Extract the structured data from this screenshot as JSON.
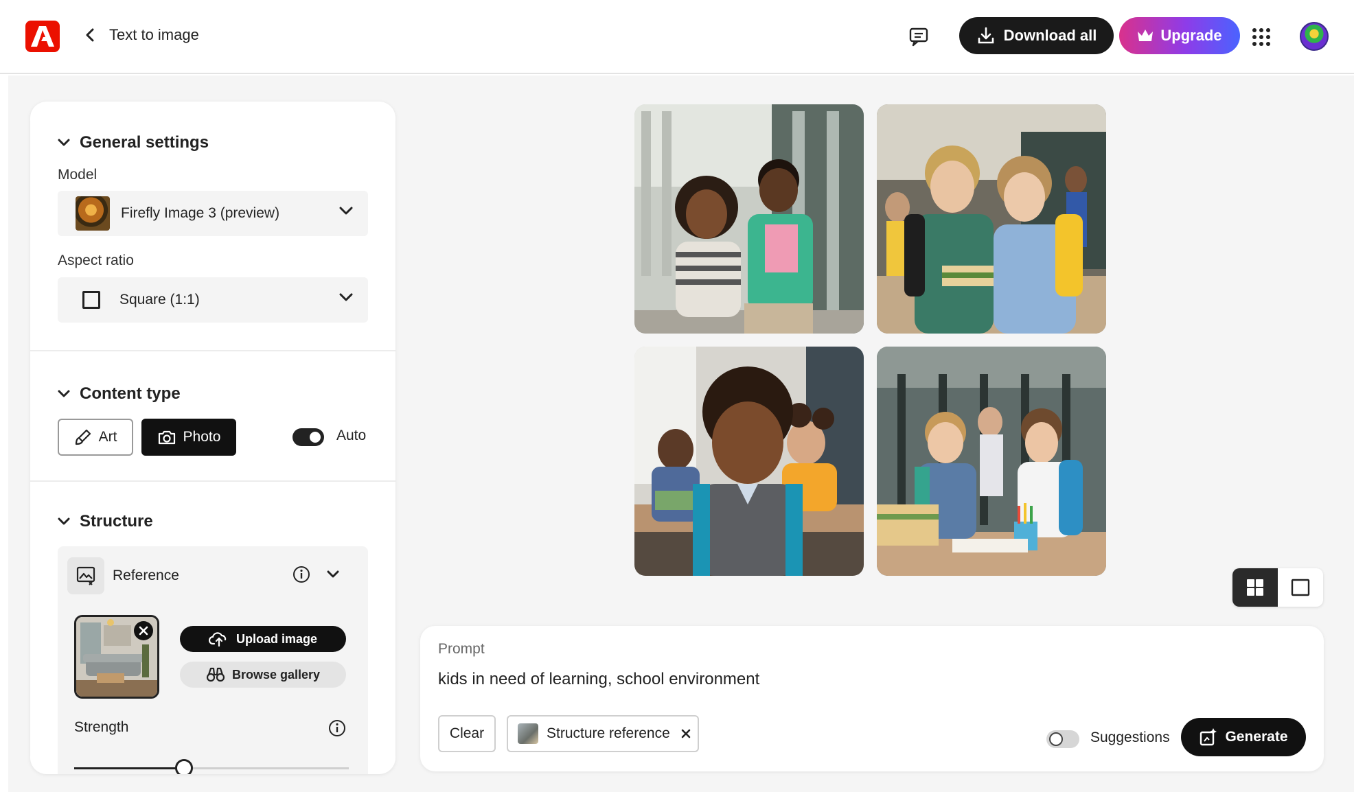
{
  "header": {
    "title": "Text to image",
    "download_label": "Download all",
    "upgrade_label": "Upgrade"
  },
  "panel": {
    "general": {
      "title": "General settings",
      "model_label": "Model",
      "model_value": "Firefly Image 3 (preview)",
      "aspect_label": "Aspect ratio",
      "aspect_value": "Square (1:1)"
    },
    "content_type": {
      "title": "Content type",
      "art_label": "Art",
      "photo_label": "Photo",
      "auto_label": "Auto",
      "selected": "Photo",
      "auto_on": true
    },
    "structure": {
      "title": "Structure",
      "reference_label": "Reference",
      "upload_label": "Upload image",
      "browse_label": "Browse gallery",
      "strength_label": "Strength",
      "strength_value": 0.4
    }
  },
  "prompt": {
    "label": "Prompt",
    "text": "kids in need of learning, school environment",
    "clear_label": "Clear",
    "chip_label": "Structure reference",
    "suggestions_label": "Suggestions",
    "suggestions_on": false,
    "generate_label": "Generate"
  },
  "view": {
    "mode": "grid"
  },
  "colors": {
    "brand_red": "#eb1000",
    "dark": "#111111",
    "upgrade_gradient": [
      "#d9318c",
      "#8e3ce8",
      "#4a63ff"
    ]
  }
}
